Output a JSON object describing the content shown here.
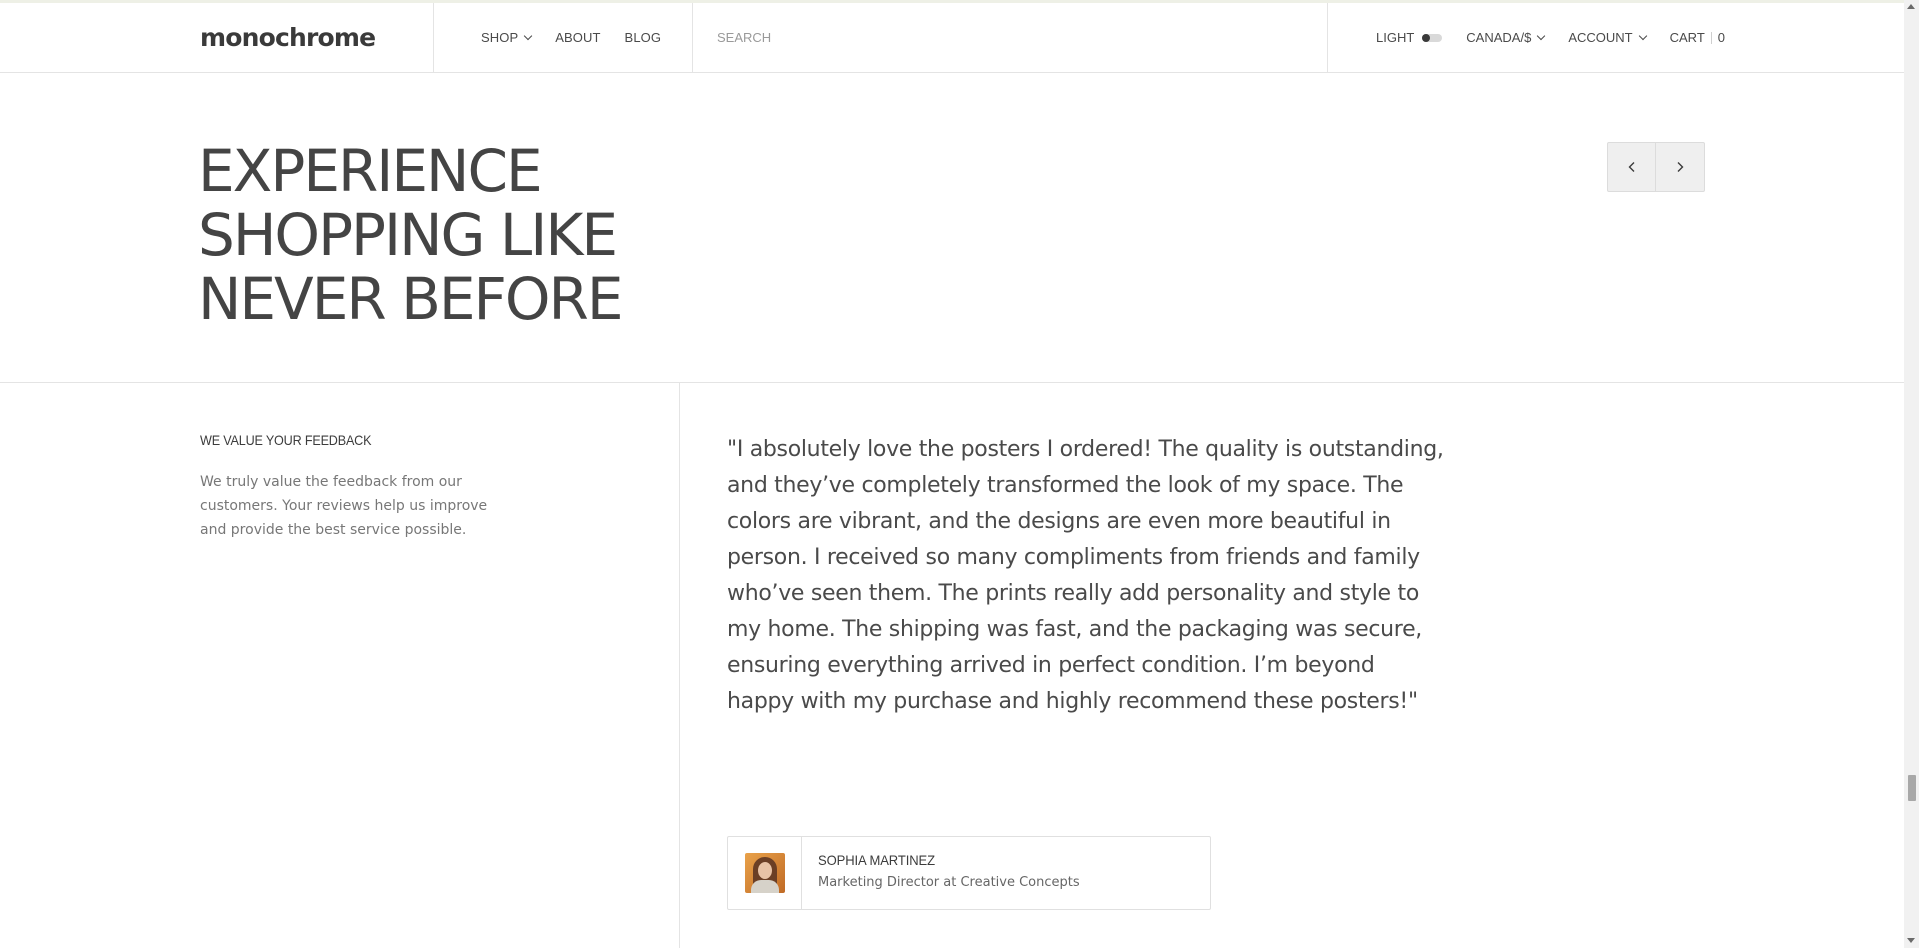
{
  "header": {
    "logo": "monochrome",
    "nav": {
      "shop": "SHOP",
      "about": "ABOUT",
      "blog": "BLOG"
    },
    "search_placeholder": "SEARCH",
    "theme_label": "LIGHT",
    "theme_toggle_on": false,
    "currency": "CANADA/$",
    "account": "ACCOUNT",
    "cart_label": "CART",
    "cart_count": "0"
  },
  "hero": {
    "title_lines": [
      "EXPERIENCE",
      "SHOPPING LIKE",
      "NEVER BEFORE"
    ]
  },
  "feedback": {
    "heading": "WE VALUE YOUR FEEDBACK",
    "description": "We truly value the feedback from our customers. Your reviews help us improve and provide the best service possible."
  },
  "testimonial": {
    "quote": "\"I absolutely love the posters I ordered! The quality is outstanding, and they’ve completely transformed the look of my space. The colors are vibrant, and the designs are even more beautiful in person. I received so many compliments from friends and family who’ve seen them. The prints really add personality and style to my home. The shipping was fast, and the packaging was secure, ensuring everything arrived in perfect condition. I’m beyond happy with my purchase and highly recommend these posters!\"",
    "author_name": "SOPHIA MARTINEZ",
    "author_role": "Marketing Director at Creative Concepts"
  },
  "colors": {
    "text": "#4a4a4a",
    "border": "#e4e4e4",
    "avatar_bg": "#d98a3a"
  },
  "icons": [
    "chevron-down-icon",
    "chevron-left-icon",
    "chevron-right-icon",
    "toggle-switch-icon"
  ]
}
